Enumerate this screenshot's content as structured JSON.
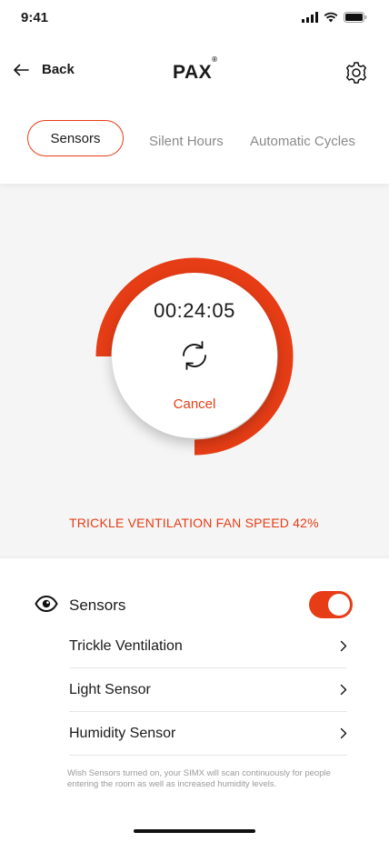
{
  "status_bar": {
    "time": "9:41"
  },
  "nav": {
    "back_label": "Back",
    "logo": "PAX",
    "logo_mark": "®"
  },
  "tabs": [
    {
      "label": "Sensors",
      "active": true
    },
    {
      "label": "Silent Hours",
      "active": false
    },
    {
      "label": "Automatic Cycles",
      "active": false
    }
  ],
  "timer": {
    "remaining": "00:24:05",
    "cancel_label": "Cancel",
    "progress_fraction": 0.75
  },
  "fan_speed_text": "TRICKLE VENTILATION FAN SPEED 42%",
  "sensors": {
    "title": "Sensors",
    "enabled": true,
    "items": [
      {
        "label": "Trickle Ventilation"
      },
      {
        "label": "Light Sensor"
      },
      {
        "label": "Humidity Sensor"
      }
    ],
    "note": "Wish Sensors turned on, your SIMX will scan continuously for people entering the room as well as increased humidity levels."
  },
  "colors": {
    "accent": "#e63d16",
    "text": "#1a1a1a",
    "muted": "#8a8a8a"
  },
  "icons": [
    "signal-icon",
    "wifi-icon",
    "battery-icon",
    "back-arrow-icon",
    "gear-icon",
    "cycle-icon",
    "eye-icon",
    "chevron-right-icon"
  ]
}
